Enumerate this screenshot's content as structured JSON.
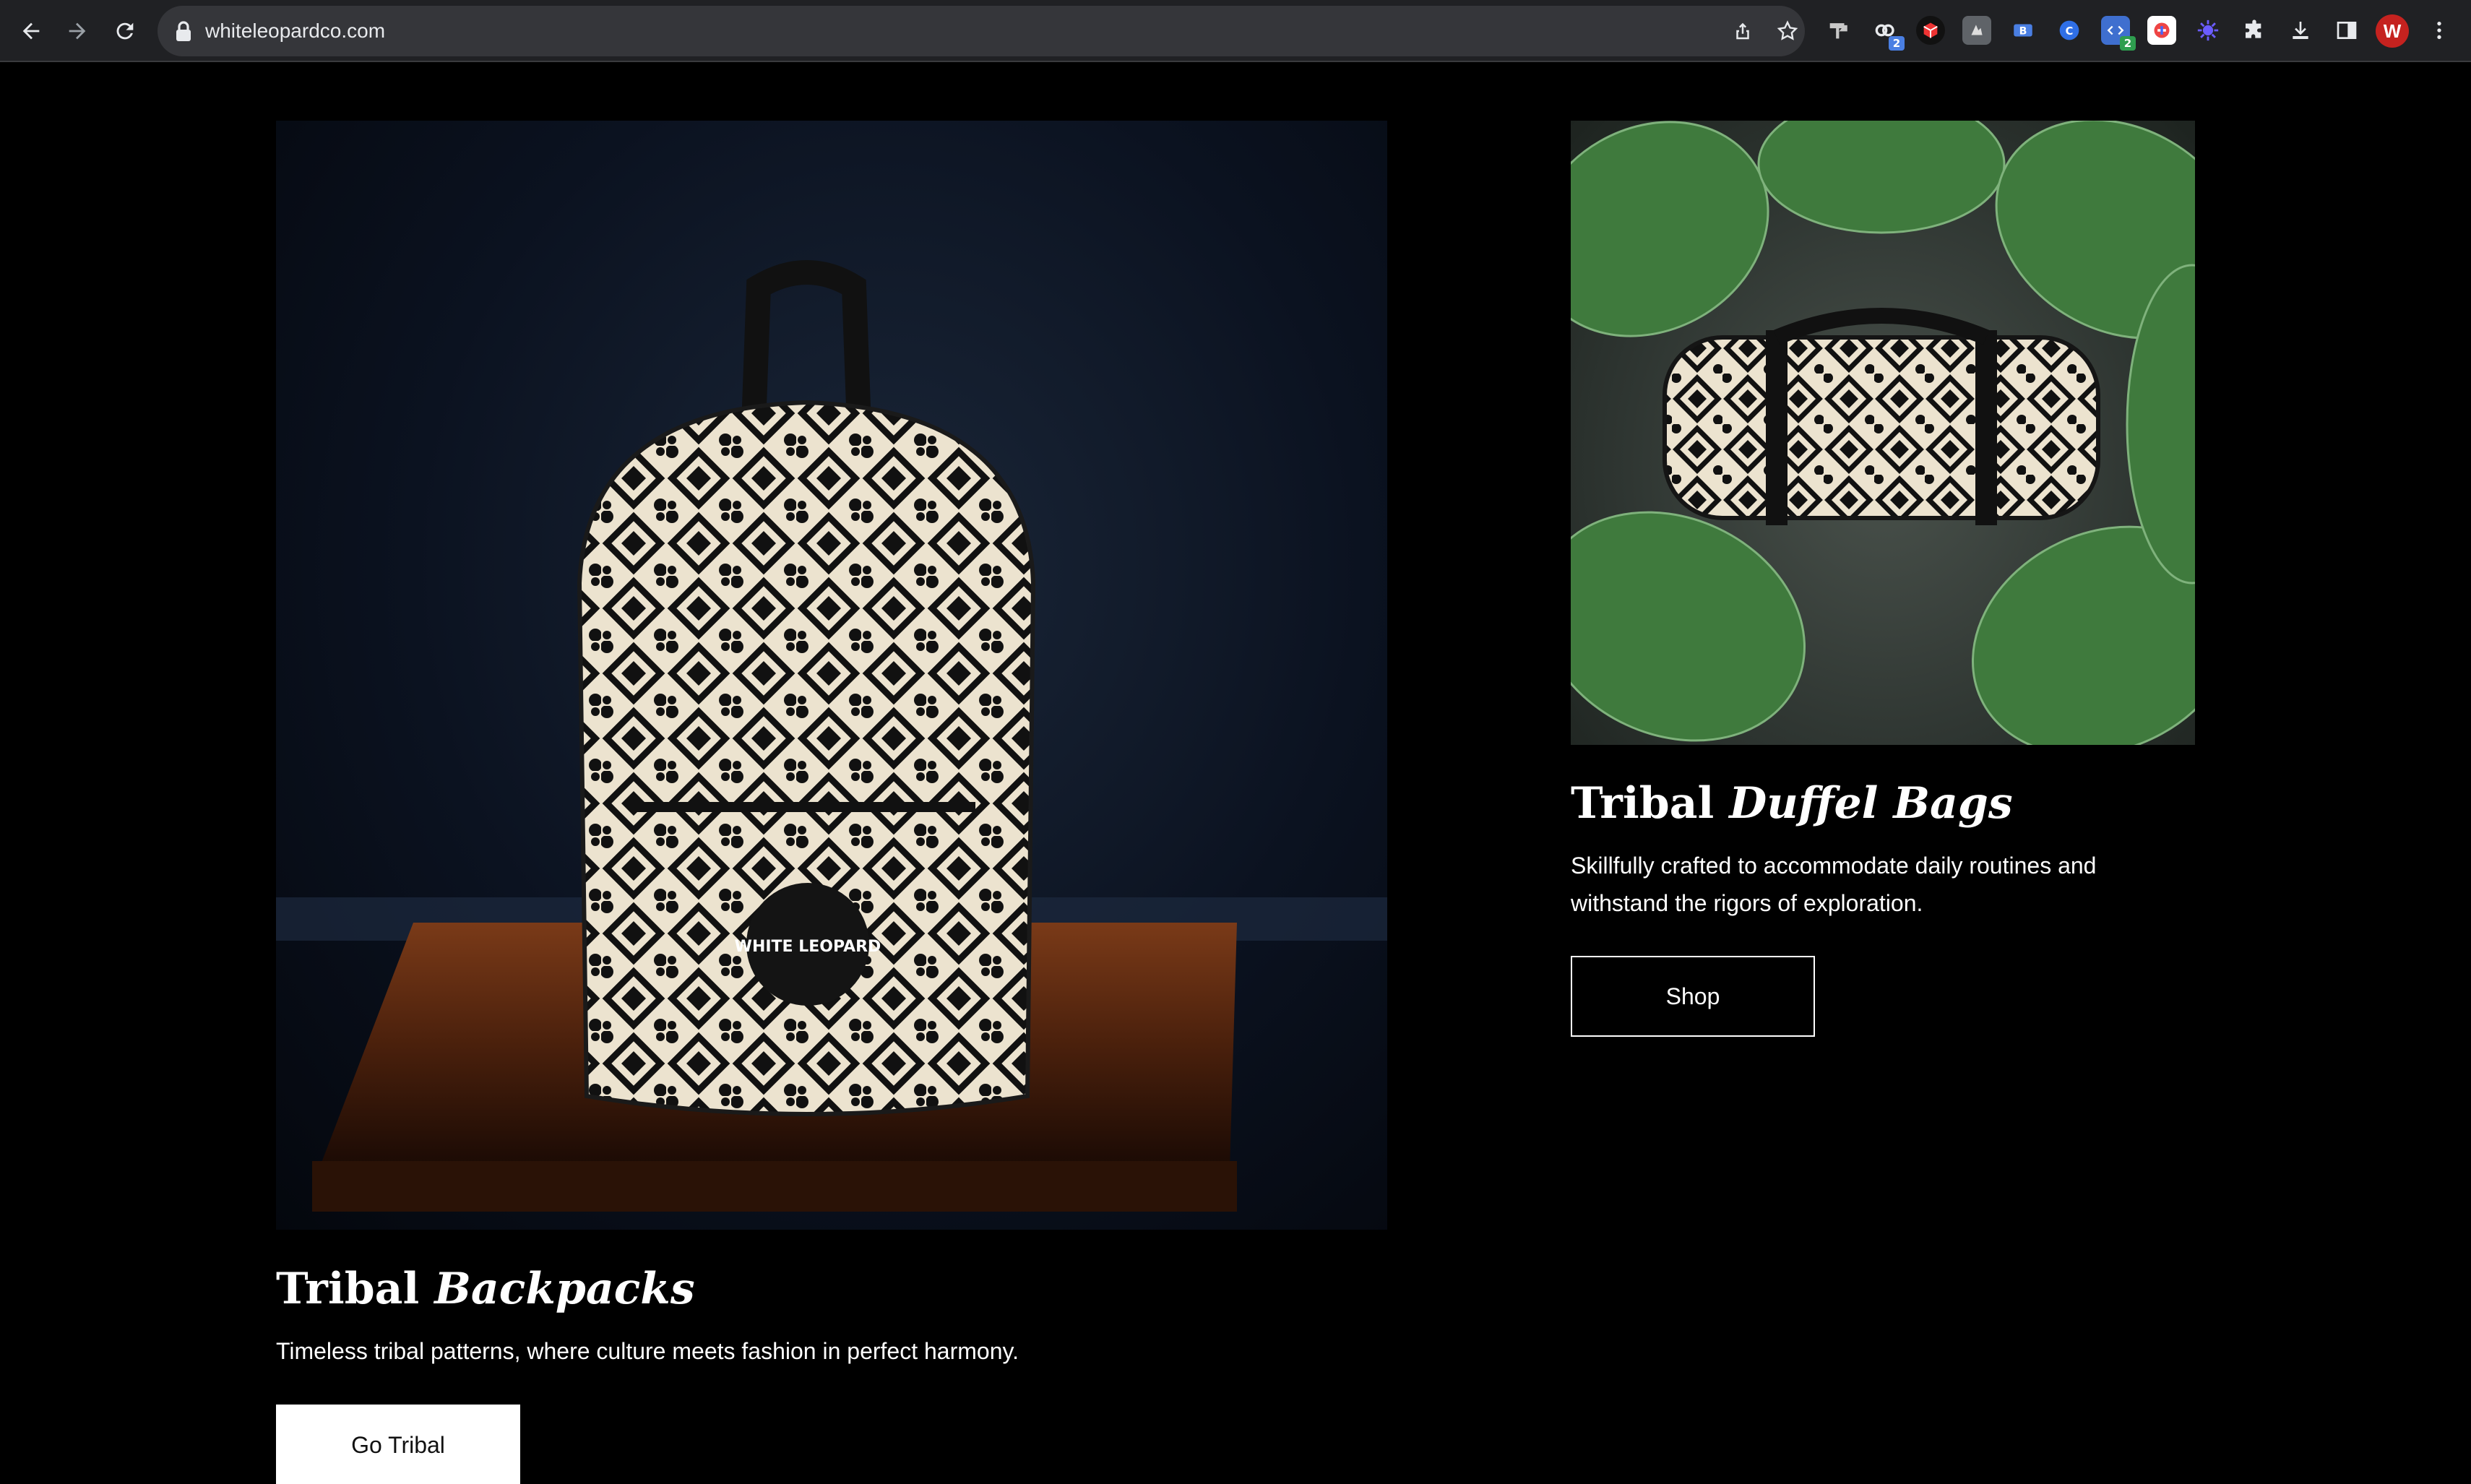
{
  "browser": {
    "url": "whiteleopardco.com",
    "profile_initial": "W",
    "extension_badges": {
      "ext2": "2",
      "ext8": "2"
    },
    "icons": [
      "back-icon",
      "forward-icon",
      "reload-icon",
      "lock-icon",
      "share-icon",
      "bookmark-star-icon",
      "extensions-puzzle-icon",
      "downloads-icon",
      "side-panel-icon",
      "kebab-menu-icon"
    ]
  },
  "backpacks": {
    "heading_plain": "Tribal ",
    "heading_italic": "Backpacks",
    "description": "Timeless tribal patterns, where culture meets fashion in perfect harmony.",
    "button_label": "Go Tribal",
    "logo_text": "WHITE LEOPARD"
  },
  "duffels": {
    "heading_plain": "Tribal ",
    "heading_italic": "Duffel Bags",
    "description_line1": "Skillfully crafted to accommodate daily routines and",
    "description_line2": "withstand the rigors of exploration.",
    "button_label": "Shop"
  }
}
